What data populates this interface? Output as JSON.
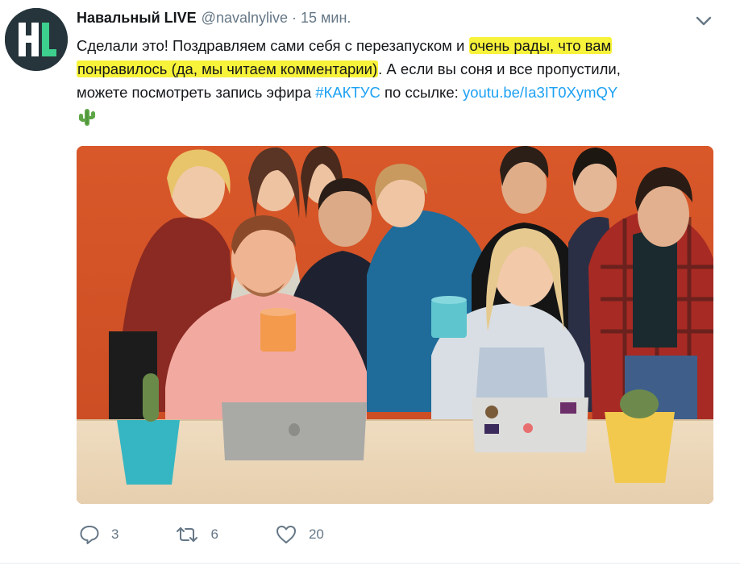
{
  "tweet": {
    "display_name": "Навальный LIVE",
    "handle": "@navalnylive",
    "separator": "·",
    "time": "15 мин.",
    "avatar_icon": "hl-logo-icon",
    "menu_icon": "chevron-down-icon",
    "text": {
      "line1_plain": "Сделали это! Поздравляем сами себя с перезапуском и ",
      "line1_highlight": "очень рады, что вам",
      "line2_highlight": "понравилось (да, мы читаем комментарии)",
      "line2_plain": ". А если вы соня и все пропустили,",
      "line3_plain_before": "можете посмотреть запись эфира ",
      "hashtag": "#КАКТУС",
      "line3_plain_mid": " по ссылке: ",
      "link": "youtu.be/Ia3IT0XymQY",
      "emoji": "cactus-icon"
    },
    "highlight_color": "#f7f23a",
    "link_color": "#1da1f2",
    "media": {
      "type": "photo",
      "background_color": "#d2562a"
    },
    "actions": {
      "reply_icon": "reply-icon",
      "reply_count": "3",
      "retweet_icon": "retweet-icon",
      "retweet_count": "6",
      "like_icon": "heart-icon",
      "like_count": "20"
    }
  }
}
